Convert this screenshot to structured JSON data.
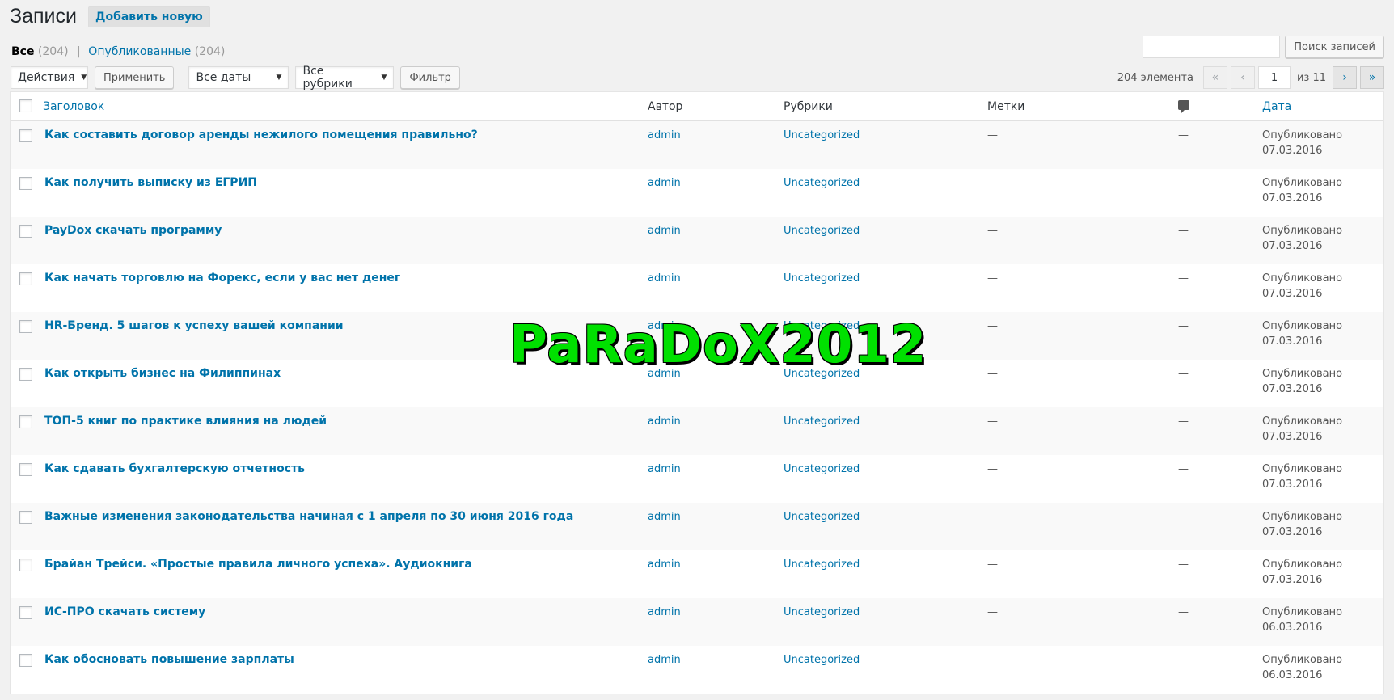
{
  "header": {
    "title": "Записи",
    "add_new_label": "Добавить новую"
  },
  "views": {
    "all_label": "Все",
    "all_count": "(204)",
    "separator": "|",
    "published_label": "Опубликованные",
    "published_count": "(204)"
  },
  "search": {
    "value": "",
    "button_label": "Поиск записей"
  },
  "filters": {
    "bulk_actions": "Действия",
    "apply_label": "Применить",
    "dates": "Все даты",
    "categories": "Все рубрики",
    "filter_label": "Фильтр"
  },
  "pagination": {
    "items_label": "204 элемента",
    "first": "«",
    "prev": "‹",
    "current_page": "1",
    "of_label": "из 11",
    "next": "›",
    "last": "»"
  },
  "columns": {
    "title": "Заголовок",
    "author": "Автор",
    "categories": "Рубрики",
    "tags": "Метки",
    "comments_icon": "comment-bubble-icon",
    "date": "Дата"
  },
  "rows": [
    {
      "title": "Как составить договор аренды нежилого помещения правильно?",
      "author": "admin",
      "category": "Uncategorized",
      "tags": "—",
      "comments": "—",
      "status": "Опубликовано",
      "date": "07.03.2016"
    },
    {
      "title": "Как получить выписку из ЕГРИП",
      "author": "admin",
      "category": "Uncategorized",
      "tags": "—",
      "comments": "—",
      "status": "Опубликовано",
      "date": "07.03.2016"
    },
    {
      "title": "PayDox скачать программу",
      "author": "admin",
      "category": "Uncategorized",
      "tags": "—",
      "comments": "—",
      "status": "Опубликовано",
      "date": "07.03.2016"
    },
    {
      "title": "Как начать торговлю на Форекс, если у вас нет денег",
      "author": "admin",
      "category": "Uncategorized",
      "tags": "—",
      "comments": "—",
      "status": "Опубликовано",
      "date": "07.03.2016"
    },
    {
      "title": "HR-Бренд. 5 шагов к успеху вашей компании",
      "author": "admin",
      "category": "Uncategorized",
      "tags": "—",
      "comments": "—",
      "status": "Опубликовано",
      "date": "07.03.2016"
    },
    {
      "title": "Как открыть бизнес на Филиппинах",
      "author": "admin",
      "category": "Uncategorized",
      "tags": "—",
      "comments": "—",
      "status": "Опубликовано",
      "date": "07.03.2016"
    },
    {
      "title": "ТОП-5 книг по практике влияния на людей",
      "author": "admin",
      "category": "Uncategorized",
      "tags": "—",
      "comments": "—",
      "status": "Опубликовано",
      "date": "07.03.2016"
    },
    {
      "title": "Как сдавать бухгалтерскую отчетность",
      "author": "admin",
      "category": "Uncategorized",
      "tags": "—",
      "comments": "—",
      "status": "Опубликовано",
      "date": "07.03.2016"
    },
    {
      "title": "Важные изменения законодательства начиная с 1 апреля по 30 июня 2016 года",
      "author": "admin",
      "category": "Uncategorized",
      "tags": "—",
      "comments": "—",
      "status": "Опубликовано",
      "date": "07.03.2016"
    },
    {
      "title": "Брайан Трейси. «Простые правила личного успеха». Аудиокнига",
      "author": "admin",
      "category": "Uncategorized",
      "tags": "—",
      "comments": "—",
      "status": "Опубликовано",
      "date": "07.03.2016"
    },
    {
      "title": "ИС-ПРО скачать систему",
      "author": "admin",
      "category": "Uncategorized",
      "tags": "—",
      "comments": "—",
      "status": "Опубликовано",
      "date": "06.03.2016"
    },
    {
      "title": "Как обосновать повышение зарплаты",
      "author": "admin",
      "category": "Uncategorized",
      "tags": "—",
      "comments": "—",
      "status": "Опубликовано",
      "date": "06.03.2016"
    }
  ],
  "watermark": "PaRaDoX2012",
  "colors": {
    "link": "#0073aa",
    "background": "#f1f1f1",
    "watermark": "#00e000"
  }
}
